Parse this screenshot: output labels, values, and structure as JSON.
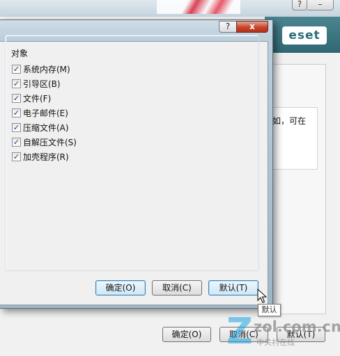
{
  "background_window": {
    "close_glyph": "?",
    "minimize_glyph": "–",
    "logo_text": "eset",
    "partial_text": "如，可在",
    "buttons": {
      "ok": "确定(O)",
      "cancel": "取消(C)",
      "default": "默认(T)"
    }
  },
  "dialog": {
    "help_glyph": "?",
    "close_glyph": "x",
    "group_title": "对象",
    "checkboxes": [
      {
        "label": "系统内存(M)",
        "checked": true
      },
      {
        "label": "引导区(B)",
        "checked": true
      },
      {
        "label": "文件(F)",
        "checked": true
      },
      {
        "label": "电子邮件(E)",
        "checked": true
      },
      {
        "label": "压缩文件(A)",
        "checked": true
      },
      {
        "label": "自解压文件(S)",
        "checked": true
      },
      {
        "label": "加壳程序(R)",
        "checked": true
      }
    ],
    "buttons": {
      "ok": "确定(O)",
      "cancel": "取消(C)",
      "default": "默认(T)"
    }
  },
  "tooltip": {
    "text": "默认"
  },
  "watermark": {
    "logo": "zol.com.cn",
    "sub": "中关村在线"
  },
  "colors": {
    "eset_teal": "#2f6873",
    "close_red": "#c7432a",
    "check_blue": "#1c3f8c"
  }
}
